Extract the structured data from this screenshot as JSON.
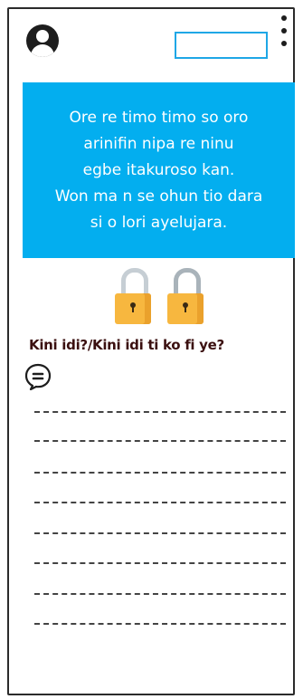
{
  "header": {
    "avatar_icon": "user-avatar-icon",
    "menu_icon": "kebab-menu-icon",
    "field_value": ""
  },
  "banner": {
    "text": "Ore re timo timo so oro\narinifin  nipa re ninu\negbe itakuroso kan.\nWon ma n se ohun tio dara\nsi o lori ayelujara.",
    "background": "#03aeef"
  },
  "locks": {
    "icon": "padlock-icon",
    "count": 2
  },
  "question": {
    "text": "Kini idi?/Kini idi ti ko fi ye?"
  },
  "answer": {
    "icon": "chat-bubble-icon",
    "line_count": 8
  }
}
